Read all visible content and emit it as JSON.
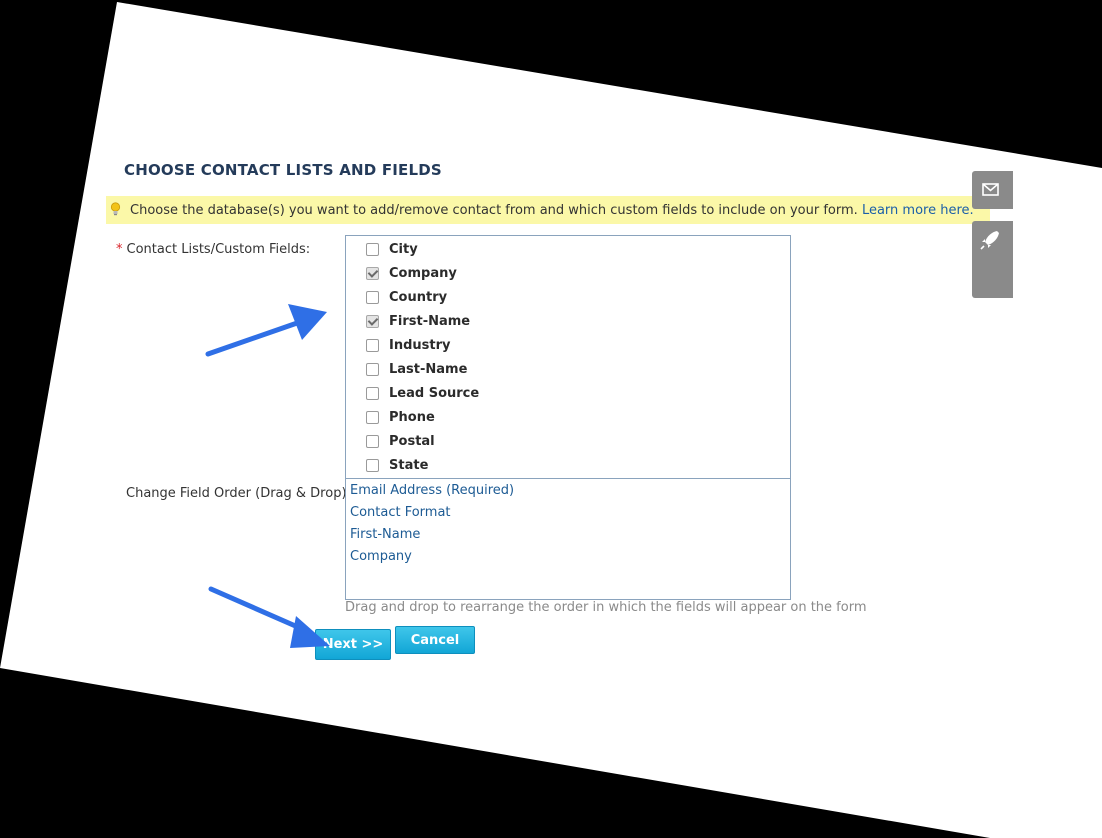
{
  "section_title": "CHOOSE CONTACT LISTS AND FIELDS",
  "tip": {
    "text": "Choose the database(s) you want to add/remove contact from and which custom fields to include on your form.",
    "link": "Learn more here."
  },
  "contact_lists_label": "Contact Lists/Custom Fields:",
  "required_marker": "*",
  "fields": [
    {
      "label": "City",
      "checked": false
    },
    {
      "label": "Company",
      "checked": true
    },
    {
      "label": "Country",
      "checked": false
    },
    {
      "label": "First-Name",
      "checked": true
    },
    {
      "label": "Industry",
      "checked": false
    },
    {
      "label": "Last-Name",
      "checked": false
    },
    {
      "label": "Lead Source",
      "checked": false
    },
    {
      "label": "Phone",
      "checked": false
    },
    {
      "label": "Postal",
      "checked": false
    },
    {
      "label": "State",
      "checked": false
    }
  ],
  "field_order_label": "Change Field Order (Drag & Drop):",
  "field_order": [
    "Email Address (Required)",
    "Contact Format",
    "First-Name",
    "Company"
  ],
  "field_order_hint": "Drag and drop to rearrange the order in which the fields will appear on the form",
  "buttons": {
    "next": "Next >>",
    "cancel": "Cancel"
  },
  "side_tools": [
    "envelope-icon",
    "rocket-icon"
  ],
  "colors": {
    "title": "#243b5a",
    "link": "#1d5b94",
    "tip_bg": "#fbf8a8",
    "button": "#1eb1df",
    "annotation_arrow": "#2f6fe6",
    "required": "#d9232a"
  }
}
